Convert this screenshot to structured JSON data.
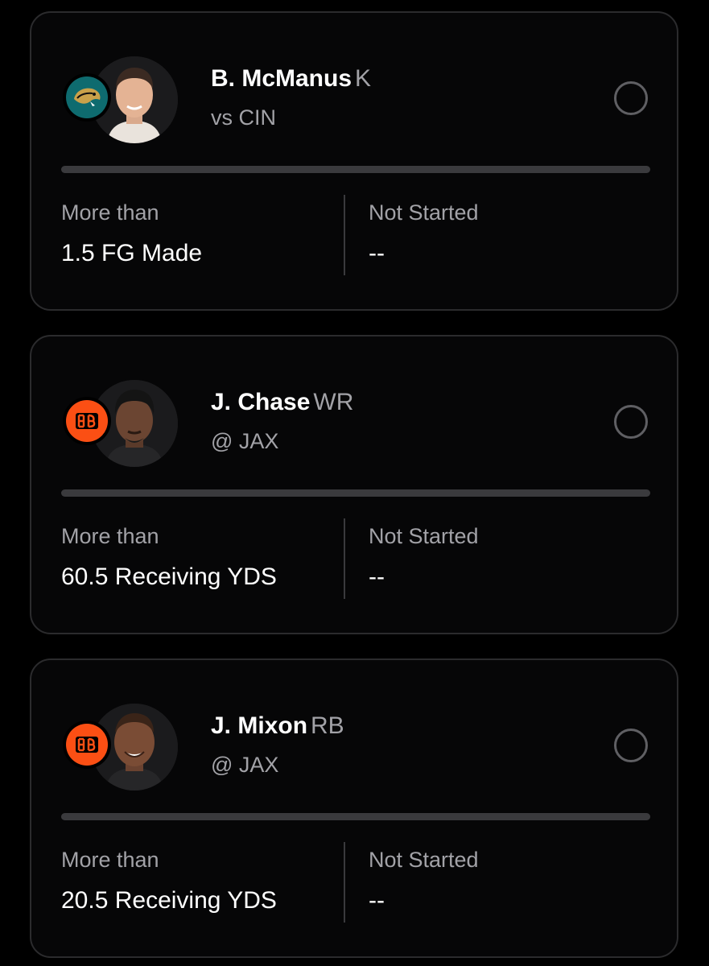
{
  "picks": [
    {
      "player_name": "B. McManus",
      "position": "K",
      "matchup": "vs CIN",
      "team_logo_icon": "jaguars-logo-icon",
      "team_color": "#0e6b6f",
      "more_label": "More than",
      "line_value": "1.5 FG Made",
      "status_label": "Not Started",
      "status_value": "--",
      "progress_fraction": 0
    },
    {
      "player_name": "J. Chase",
      "position": "WR",
      "matchup": "@ JAX",
      "team_logo_icon": "bengals-logo-icon",
      "team_color": "#fb4f14",
      "more_label": "More than",
      "line_value": "60.5 Receiving YDS",
      "status_label": "Not Started",
      "status_value": "--",
      "progress_fraction": 0
    },
    {
      "player_name": "J. Mixon",
      "position": "RB",
      "matchup": "@ JAX",
      "team_logo_icon": "bengals-logo-icon",
      "team_color": "#fb4f14",
      "more_label": "More than",
      "line_value": "20.5 Receiving YDS",
      "status_label": "Not Started",
      "status_value": "--",
      "progress_fraction": 0
    }
  ],
  "colors": {
    "background": "#000000",
    "card_border": "#2b2b2d",
    "secondary_text": "#a2a2a7",
    "radio_border": "#5f5f63"
  }
}
